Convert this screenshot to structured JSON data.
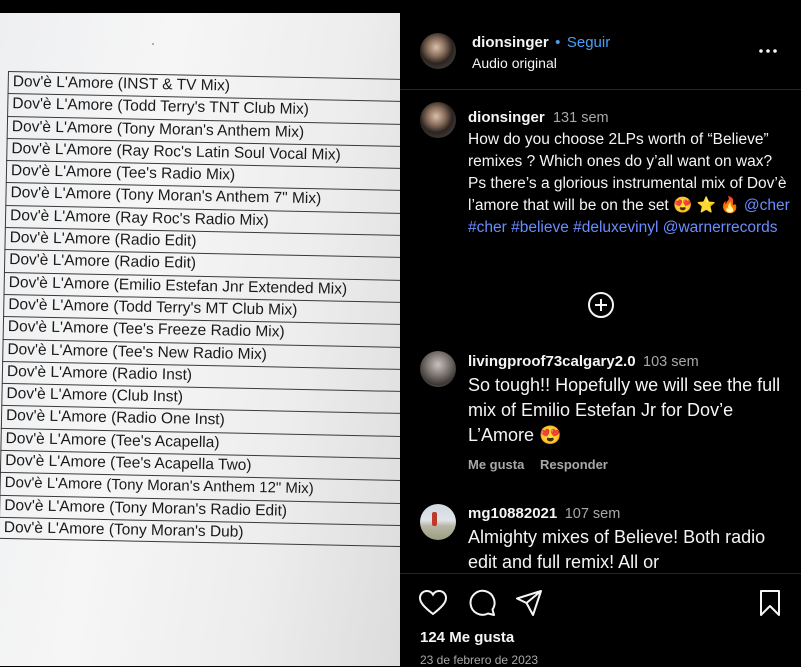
{
  "photo": {
    "tracks": [
      "Dov'è L'Amore (INST & TV Mix)",
      "Dov'è L'Amore (Todd Terry's TNT Club Mix)",
      "Dov'è L'Amore (Tony Moran's Anthem Mix)",
      "Dov'è L'Amore (Ray Roc's Latin Soul Vocal Mix)",
      "Dov'è L'Amore (Tee's Radio Mix)",
      "Dov'è L'Amore (Tony Moran's Anthem 7\" Mix)",
      "Dov'è L'Amore (Ray Roc's Radio Mix)",
      "Dov'è L'Amore (Radio Edit)",
      "Dov'è L'Amore (Radio Edit)",
      "Dov'è L'Amore (Emilio Estefan Jnr Extended Mix)",
      "Dov'è L'Amore (Todd Terry's MT Club Mix)",
      "Dov'è L'Amore (Tee's Freeze Radio Mix)",
      "Dov'è L'Amore (Tee's New Radio Mix)",
      "Dov'è L'Amore (Radio Inst)",
      "Dov'è L'Amore (Club Inst)",
      "Dov'è L'Amore (Radio One Inst)",
      "Dov'è L'Amore (Tee's Acapella)",
      "Dov'è L'Amore (Tee's Acapella Two)",
      "Dov'è L'Amore (Tony Moran's Anthem 12\" Mix)",
      "Dov'è L'Amore (Tony Moran's Radio Edit)",
      "Dov'è L'Amore (Tony Moran's Dub)"
    ]
  },
  "header": {
    "username": "dionsinger",
    "separator": "•",
    "follow_label": "Seguir",
    "audio_label": "Audio original",
    "more_icon": "more-horizontal-icon"
  },
  "caption": {
    "username": "dionsinger",
    "time": "131 sem",
    "text": "How do you choose 2LPs worth of “Believe” remixes ? Which ones do y’all want on wax?  Ps there’s a glorious instrumental mix of Dov’è l’amore that will be on the set",
    "emojis": "😍 ⭐ 🔥",
    "tags": "@cher #cher #believe #deluxevinyl @warnerrecords"
  },
  "load_more_icon": "plus-circle-icon",
  "comments": [
    {
      "username": "livingproof73calgary2.0",
      "time": "103 sem",
      "text": "So tough!! Hopefully we will see the full mix of Emilio Estefan Jr for Dov’e L’Amore 😍",
      "like_label": "Me gusta",
      "reply_label": "Responder"
    },
    {
      "username": "mg10882021",
      "time": "107 sem",
      "text": "Almighty mixes of Believe! Both radio edit and full remix! All or"
    }
  ],
  "footer": {
    "likes": "124 Me gusta",
    "date": "23 de febrero de 2023",
    "icons": [
      "heart-icon",
      "comment-icon",
      "share-icon",
      "bookmark-icon"
    ]
  },
  "colors": {
    "background": "#000000",
    "text": "#f5f5f5",
    "muted": "#a8a8a8",
    "follow": "#4a9ff5",
    "hashtag": "#6a8dff"
  }
}
